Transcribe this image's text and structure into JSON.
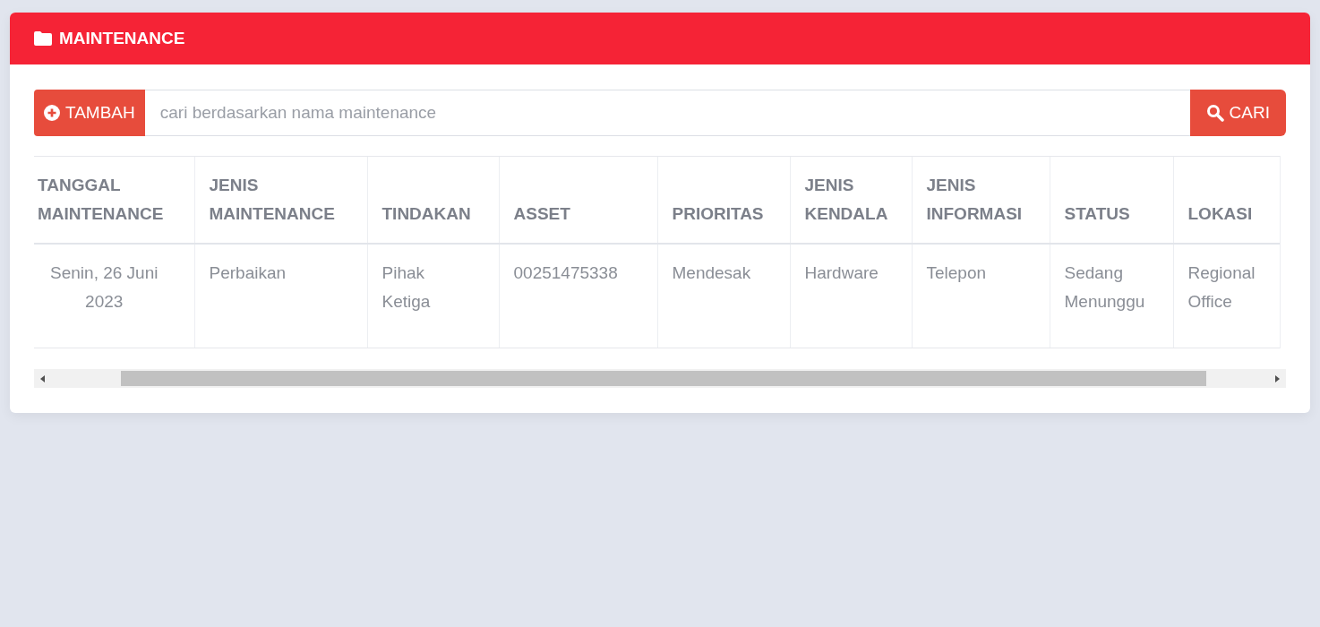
{
  "panel": {
    "title": "MAINTENANCE"
  },
  "toolbar": {
    "add_button": "TAMBAH",
    "search": {
      "placeholder": "cari berdasarkan nama maintenance"
    },
    "search_button": "CARI"
  },
  "table": {
    "columns": [
      "TANGGAL MAINTENANCE",
      "JENIS MAINTENANCE",
      "TINDAKAN",
      "ASSET",
      "PRIORITAS",
      "JENIS KENDALA",
      "JENIS INFORMASI",
      "STATUS",
      "LOKASI"
    ],
    "rows": [
      [
        "Senin, 26 Juni 2023",
        "Perbaikan",
        "Pihak Ketiga",
        "00251475338",
        "Mendesak",
        "Hardware",
        "Telepon",
        "Sedang Menunggu",
        "Regional Office"
      ]
    ]
  }
}
